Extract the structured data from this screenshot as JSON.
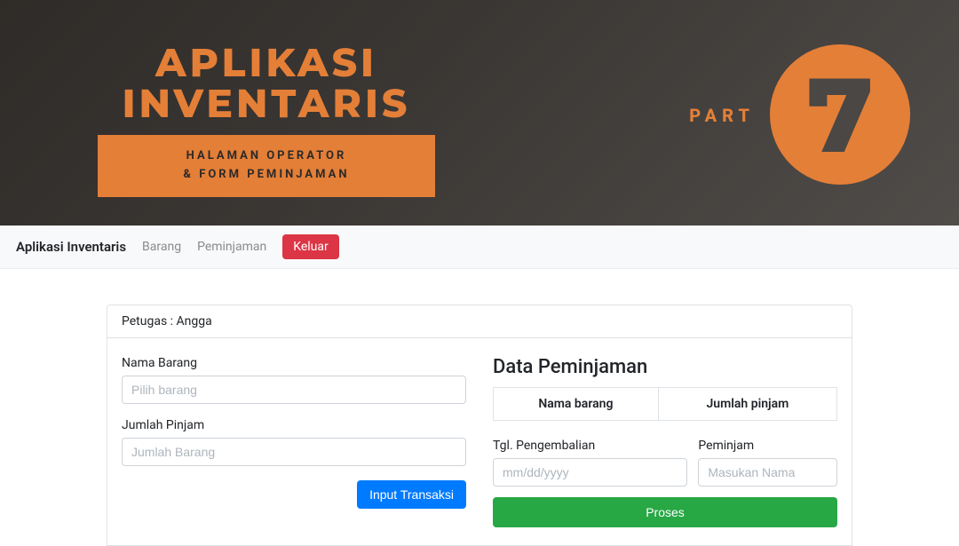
{
  "banner": {
    "title_line1": "APLIKASI",
    "title_line2": "INVENTARIS",
    "subtitle_line1": "HALAMAN OPERATOR",
    "subtitle_line2": "& FORM PEMINJAMAN",
    "part_label": "PART",
    "part_number": "7"
  },
  "nav": {
    "brand": "Aplikasi Inventaris",
    "links": [
      "Barang",
      "Peminjaman"
    ],
    "keluar": "Keluar"
  },
  "card": {
    "petugas": "Petugas : Angga"
  },
  "form_left": {
    "nama_barang_label": "Nama Barang",
    "nama_barang_placeholder": "Pilih barang",
    "jumlah_pinjam_label": "Jumlah Pinjam",
    "jumlah_pinjam_placeholder": "Jumlah Barang",
    "submit": "Input Transaksi"
  },
  "form_right": {
    "title": "Data Peminjaman",
    "th_nama": "Nama barang",
    "th_jumlah": "Jumlah pinjam",
    "tgl_label": "Tgl. Pengembalian",
    "tgl_placeholder": "mm/dd/yyyy",
    "peminjam_label": "Peminjam",
    "peminjam_placeholder": "Masukan Nama",
    "proses": "Proses"
  }
}
